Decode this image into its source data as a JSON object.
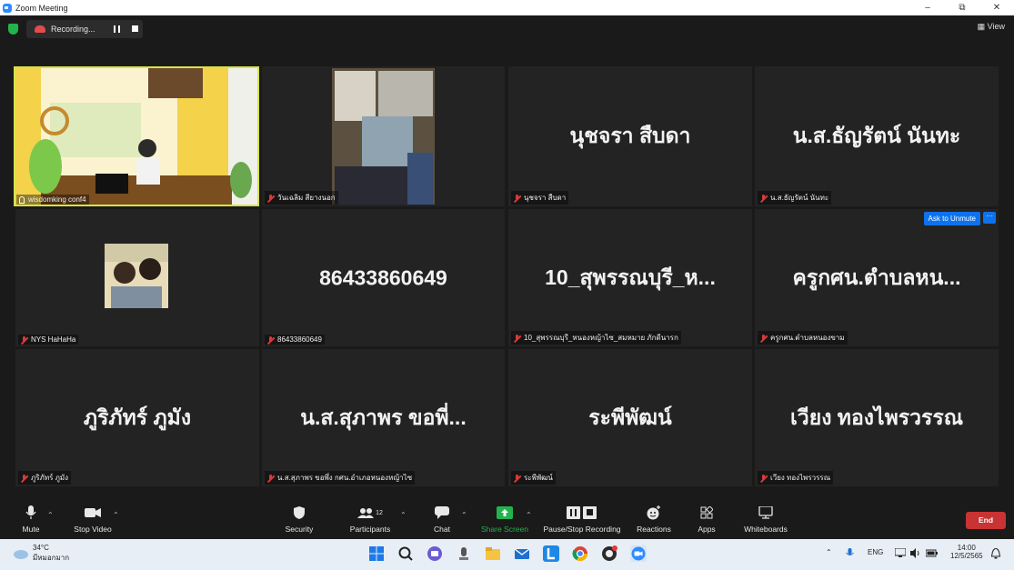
{
  "window": {
    "title": "Zoom Meeting",
    "minimize": "–",
    "maximize": "⧉",
    "close": "✕"
  },
  "topbar": {
    "recording_label": "Recording...",
    "view_label": "View"
  },
  "tiles": [
    {
      "label": "wisdomking conf4",
      "big": ""
    },
    {
      "label": "วันเฉลิม สียางนอก",
      "big": ""
    },
    {
      "label": "นุชจรา สืบดา",
      "big": "นุชจรา สืบดา"
    },
    {
      "label": "น.ส.ธัญรัตน์ นันทะ",
      "big": "น.ส.ธัญรัตน์ นันทะ"
    },
    {
      "label": "NYS HaHaHa",
      "big": ""
    },
    {
      "label": "86433860649",
      "big": "86433860649"
    },
    {
      "label": "10_สุพรรณบุรี_หนองหญ้าไซ_สมหมาย ภักดีนารก",
      "big": "10_สุพรรณบุรี_ห..."
    },
    {
      "label": "ครูกศน.ตำบลหนองขาม",
      "big": "ครูกศน.ตำบลหน..."
    },
    {
      "label": "ภูริภัทร์ ภูมัง",
      "big": "ภูริภัทร์ ภูมัง"
    },
    {
      "label": "น.ส.สุภาพร ขอพึ่ง กศน.อำเภอหนองหญ้าไซ",
      "big": "น.ส.สุภาพร ขอพี่..."
    },
    {
      "label": "ระพีพัฒน์",
      "big": "ระพีพัฒน์"
    },
    {
      "label": "เวียง ทองไพรวรรณ",
      "big": "เวียง ทองไพรวรรณ"
    }
  ],
  "tile8_actions": {
    "ask_to_unmute": "Ask to Unmute",
    "more": "···"
  },
  "toolbar": {
    "mute": "Mute",
    "stop_video": "Stop Video",
    "security": "Security",
    "participants": "Participants",
    "participants_count": "12",
    "chat": "Chat",
    "share_screen": "Share Screen",
    "pause_stop_recording": "Pause/Stop Recording",
    "reactions": "Reactions",
    "apps": "Apps",
    "whiteboards": "Whiteboards",
    "end": "End"
  },
  "taskbar": {
    "weather_temp": "34°C",
    "weather_desc": "มีหมอกมาก",
    "language": "ENG",
    "time": "14:00",
    "date": "12/5/2565"
  },
  "colors": {
    "active_speaker_border": "#d7e34a",
    "share_green": "#22b34d",
    "end_red": "#c93333",
    "zoom_blue": "#0e72ed"
  }
}
